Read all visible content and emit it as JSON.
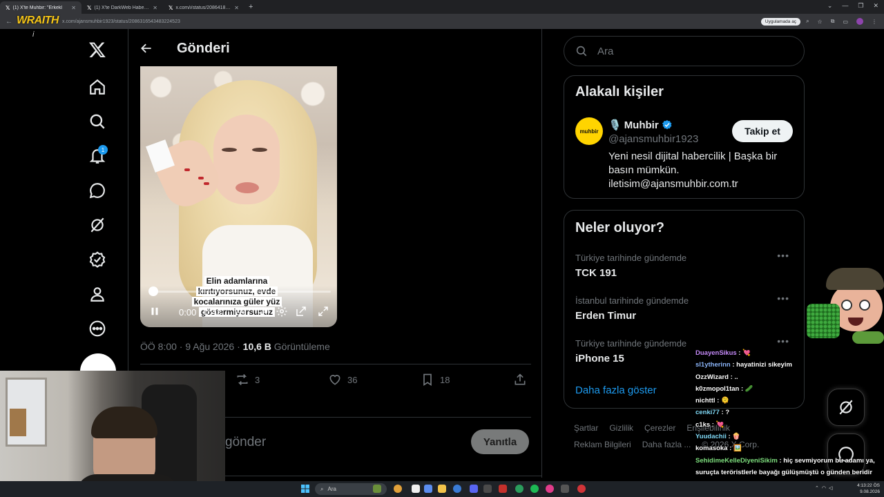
{
  "browser": {
    "tabs": [
      {
        "label": "(1) X'te  Muhbir: \"Erkekl",
        "active": true
      },
      {
        "label": "(1) X'te DarkWeb Haber: \"Ev su",
        "active": false
      },
      {
        "label": "x.com/i/status/208641899921",
        "active": false
      }
    ],
    "url": "x.com/ajansmuhbir1923/status/2086316543483224523",
    "app_chip": "Uygulamada aç",
    "overlay_logo": "WRAITH",
    "overlay_mark": "i"
  },
  "nav": {
    "notification_count": "1",
    "icons": [
      "x-logo-icon",
      "home-icon",
      "search-icon",
      "notifications-icon",
      "messages-icon",
      "grok-icon",
      "verified-icon",
      "profile-icon",
      "more-icon"
    ]
  },
  "post": {
    "page_title": "Gönderi",
    "video": {
      "caption": "Elin adamlarına kırıtıyorsunuz, evde kocalarınıza güler yüz göstermiyorsunuz",
      "time": "0:00 / 0:43",
      "progress": 0.02
    },
    "meta_time": "ÖÖ 8:00 · 9 Ağu 2026 · ",
    "meta_views_value": "10,6 B",
    "meta_views_label": " Görüntüleme",
    "retweets": "3",
    "likes": "36",
    "bookmarks": "18",
    "reply_placeholder": "gönder",
    "reply_button": "Yanıtla"
  },
  "sidebar": {
    "search_placeholder": "Ara",
    "related": {
      "title": "Alakalı kişiler",
      "name": "Muhbir",
      "emoji": "🎙️",
      "handle": "@ajansmuhbir1923",
      "follow": "Takip et",
      "bio": "Yeni nesil dijital habercilik | Başka bir basın mümkün. iletisim@ajansmuhbir.com.tr",
      "logo_text": "muhbir"
    },
    "trending": {
      "title": "Neler oluyor?",
      "items": [
        {
          "category": "Türkiye tarihinde gündemde",
          "name": "TCK 191"
        },
        {
          "category": "İstanbul tarihinde gündemde",
          "name": "Erden Timur"
        },
        {
          "category": "Türkiye tarihinde gündemde",
          "name": "iPhone 15"
        }
      ],
      "show_more": "Daha fazla göster"
    },
    "footer": {
      "row1": [
        "Şartlar",
        "Gizlilik",
        "Çerezler",
        "Erişilebilirlik"
      ],
      "row2": [
        "Reklam Bilgileri",
        "Daha fazla ...",
        "© 2026 X Corp."
      ]
    }
  },
  "chat": [
    {
      "user": "DuayenSikus",
      "color": "#c58af9",
      "msg": "💘"
    },
    {
      "user": "sl1ytherinn",
      "color": "#8ab4f8",
      "msg": "hayatinizi sikeyim"
    },
    {
      "user": "OzzWizard",
      "color": "#ffffff",
      "msg": ".."
    },
    {
      "user": "k0zmopol1tan",
      "color": "#ffffff",
      "msg": "🥒"
    },
    {
      "user": "nichttl",
      "color": "#ffffff",
      "msg": "🫠"
    },
    {
      "user": "cenki77",
      "color": "#7fd8f5",
      "msg": "?"
    },
    {
      "user": "c1ks",
      "color": "#ffffff",
      "msg": "💘"
    },
    {
      "user": "Yuudachii",
      "color": "#7fd8f5",
      "msg": "🍿"
    },
    {
      "user": "komasoka",
      "color": "#ffffff",
      "msg": "🖼️"
    },
    {
      "user": "SehidimeKelleDiyeniSikim",
      "color": "#7ee07e",
      "msg": "hiç sevmiyorum bu adamı ya, suruçta teröristlerle bayağı gülüşmüştü o günden beridir sevemiyorum"
    }
  ],
  "taskbar": {
    "search": "Ara",
    "time": "4:13:22 ÖS",
    "date": "9.08.2026"
  }
}
